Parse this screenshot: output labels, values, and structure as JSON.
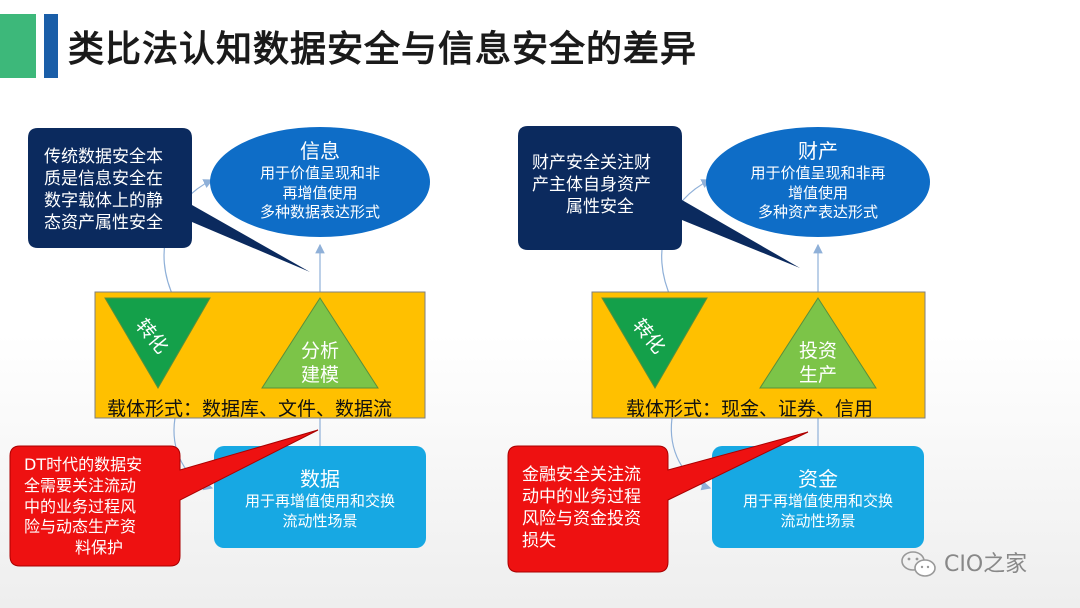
{
  "title": "类比法认知数据安全与信息安全的差异",
  "left": {
    "top_ellipse": {
      "heading": "信息",
      "lines": [
        "用于价值呈现和非",
        "再增值使用",
        "多种数据表达形式"
      ]
    },
    "callout_top": {
      "lines": [
        "传统数据安全本",
        "质是信息安全在",
        "数字载体上的静",
        "态资产属性安全"
      ]
    },
    "left_triangle": "转化",
    "right_triangle": [
      "分析",
      "建模"
    ],
    "carrier_label": "载体形式：数据库、文件、数据流",
    "bottom_box": {
      "heading": "数据",
      "lines": [
        "用于再增值使用和交换",
        "流动性场景"
      ]
    },
    "callout_bottom": {
      "lines": [
        "DT时代的数据安",
        "全需要关注流动",
        "中的业务过程风",
        "险与动态生产资",
        "料保护"
      ]
    }
  },
  "right": {
    "top_ellipse": {
      "heading": "财产",
      "lines": [
        "用于价值呈现和非再",
        "增值使用",
        "多种资产表达形式"
      ]
    },
    "callout_top": {
      "lines": [
        "财产安全关注财",
        "产主体自身资产",
        "属性安全"
      ]
    },
    "left_triangle": "转化",
    "right_triangle": [
      "投资",
      "生产"
    ],
    "carrier_label": "载体形式：现金、证券、信用",
    "bottom_box": {
      "heading": "资金",
      "lines": [
        "用于再增值使用和交换",
        "流动性场景"
      ]
    },
    "callout_bottom": {
      "lines": [
        "金融安全关注流",
        "动中的业务过程",
        "风险与资金投资",
        "损失"
      ]
    }
  },
  "watermark": "CIO之家",
  "colors": {
    "navy": "#0b2a5e",
    "ellipse_blue": "#0e6dc7",
    "carrier_yellow": "#ffc000",
    "triangle_dark_green": "#14a04a",
    "triangle_light_green": "#7cc448",
    "box_cyan": "#17a8e3",
    "alert_red": "#ee1111",
    "title_green": "#3db87a",
    "title_blue": "#1a5ea8"
  }
}
